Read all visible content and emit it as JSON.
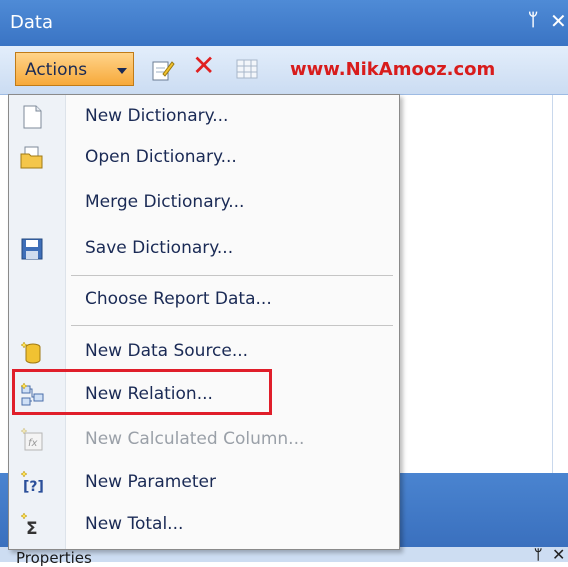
{
  "window": {
    "title": "Data"
  },
  "toolbar": {
    "actions_label": "Actions",
    "website": "www.NikAmooz.com"
  },
  "menu": {
    "items": [
      {
        "label": "New Dictionary...",
        "icon": "new-document-icon",
        "enabled": true
      },
      {
        "label": "Open Dictionary...",
        "icon": "open-folder-icon",
        "enabled": true
      },
      {
        "label": "Merge Dictionary...",
        "icon": "",
        "enabled": true
      },
      {
        "label": "Save Dictionary...",
        "icon": "save-disk-icon",
        "enabled": true
      },
      {
        "label": "Choose Report Data...",
        "icon": "",
        "enabled": true
      },
      {
        "label": "New Data Source...",
        "icon": "new-data-source-icon",
        "enabled": true
      },
      {
        "label": "New Relation...",
        "icon": "new-relation-icon",
        "enabled": true
      },
      {
        "label": "New Calculated Column...",
        "icon": "calculated-column-icon",
        "enabled": false
      },
      {
        "label": "New Parameter",
        "icon": "new-parameter-icon",
        "enabled": true
      },
      {
        "label": "New Total...",
        "icon": "new-total-icon",
        "enabled": true
      }
    ]
  },
  "bottom_panel": {
    "title": "Properties"
  },
  "colors": {
    "title_bar": "#3a74c4",
    "actions_button": "#f7a93a",
    "highlight": "#e01e2a",
    "website": "#d81c1c"
  }
}
